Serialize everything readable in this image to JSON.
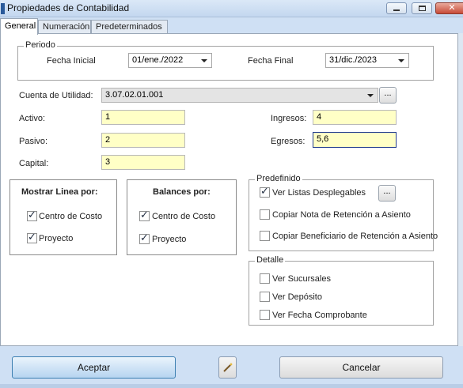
{
  "window": {
    "title": "Propiedades de Contabilidad",
    "controls": [
      "minimize-icon",
      "maximize-icon",
      "close-icon"
    ]
  },
  "tabs": [
    {
      "label": "General",
      "active": true
    },
    {
      "label": "Numeración",
      "active": false
    },
    {
      "label": "Predeterminados",
      "active": false
    }
  ],
  "periodo": {
    "legend": "Periodo",
    "fecha_inicial_label": "Fecha Inicial",
    "fecha_inicial_value": "01/ene./2022",
    "fecha_final_label": "Fecha Final",
    "fecha_final_value": "31/dic./2023"
  },
  "cuenta_utilidad": {
    "label": "Cuenta de Utilidad:",
    "value": "3.07.02.01.001",
    "browse_label": "..."
  },
  "fields": {
    "activo": {
      "label": "Activo:",
      "value": "1"
    },
    "pasivo": {
      "label": "Pasivo:",
      "value": "2"
    },
    "capital": {
      "label": "Capital:",
      "value": "3"
    },
    "ingresos": {
      "label": "Ingresos:",
      "value": "4"
    },
    "egresos": {
      "label": "Egresos:",
      "value": "5,6"
    }
  },
  "mostrar_linea": {
    "title": "Mostrar Linea por:",
    "items": [
      {
        "label": "Centro de Costo",
        "checked": true
      },
      {
        "label": "Proyecto",
        "checked": true
      }
    ]
  },
  "balances": {
    "title": "Balances por:",
    "items": [
      {
        "label": "Centro de Costo",
        "checked": true
      },
      {
        "label": "Proyecto",
        "checked": true
      }
    ]
  },
  "predefinido": {
    "legend": "Predefinido",
    "browse_label": "...",
    "items": [
      {
        "label": "Ver Listas Desplegables",
        "checked": true
      },
      {
        "label": "Copiar Nota de Retención a Asiento",
        "checked": false
      },
      {
        "label": "Copiar Beneficiario de Retención a Asiento",
        "checked": false
      }
    ]
  },
  "detalle": {
    "legend": "Detalle",
    "items": [
      {
        "label": "Ver Sucursales",
        "checked": false
      },
      {
        "label": "Ver Depósito",
        "checked": false
      },
      {
        "label": "Ver Fecha Comprobante",
        "checked": false
      }
    ]
  },
  "buttons": {
    "accept": "Aceptar",
    "cancel": "Cancelar",
    "magic_icon": "magic-wand-icon"
  },
  "colors": {
    "input_bg": "#ffffc6",
    "accept_border": "#3c7fb1",
    "window_bg": "#cfe0f4"
  }
}
